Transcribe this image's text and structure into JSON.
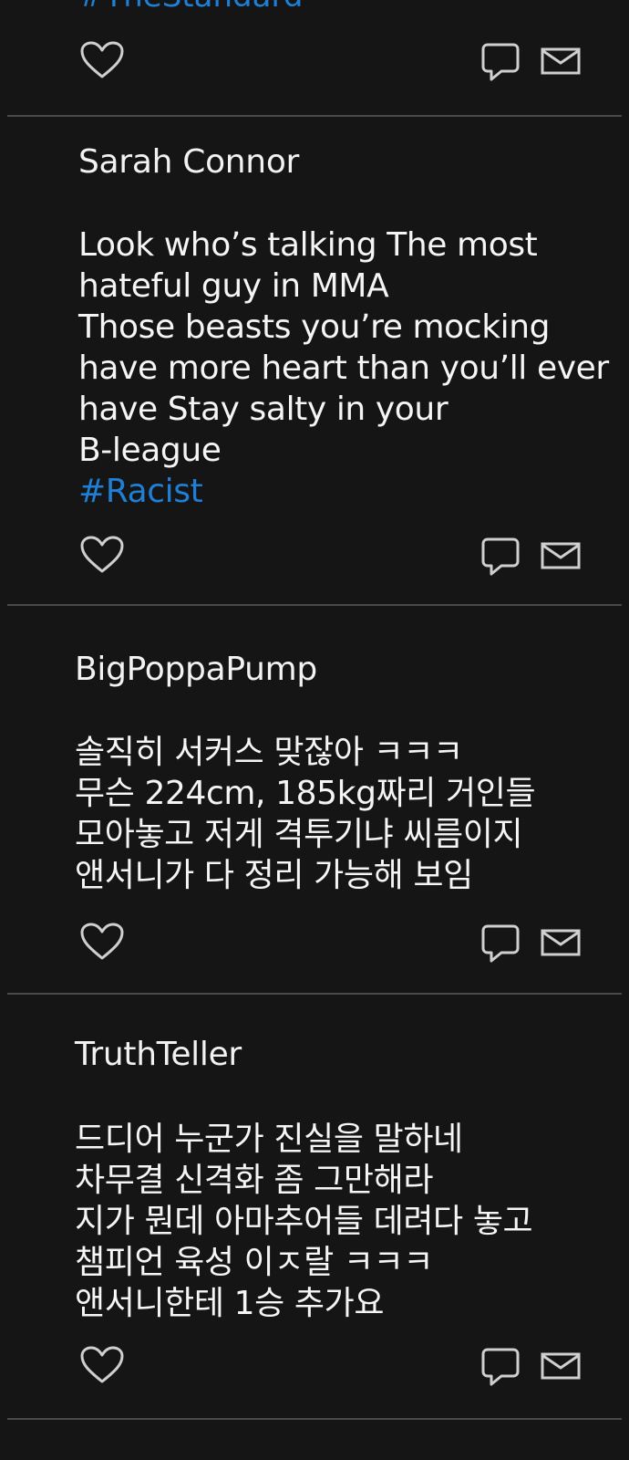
{
  "feed": {
    "top_post": {
      "hashtag": "#TheStandard"
    },
    "posts": [
      {
        "author": "Sarah Connor",
        "lines": [
          "Look who’s talking The most",
          "hateful guy in MMA",
          "Those beasts you’re mocking",
          "have more heart than you’ll ever",
          "have Stay salty in your",
          "B-league"
        ],
        "hashtag": "#Racist"
      },
      {
        "author": "BigPoppaPump",
        "lines": [
          "솔직히 서커스 맞잖아 ㅋㅋㅋ",
          "무슨 224cm, 185kg짜리 거인들",
          "모아놓고 저게 격투기냐 씨름이지",
          "앤서니가 다 정리 가능해 보임"
        ]
      },
      {
        "author": "TruthTeller",
        "lines": [
          "드디어 누군가 진실을 말하네",
          "차무결 신격화 좀 그만해라",
          "지가 뭔데 아마추어들  데려다 놓고",
          "챔피언 육성 이ㅈ랄 ㅋㅋㅋ",
          "앤서니한테 1승 추가요"
        ]
      }
    ],
    "icons": {
      "like": "heart-icon",
      "comment": "speech-bubble-icon",
      "message": "envelope-icon"
    },
    "colors": {
      "background": "#151515",
      "text": "#f2f2f2",
      "hashtag": "#1f7fd4",
      "divider": "#4a4a4a",
      "icon": "#cfcfcf"
    }
  }
}
